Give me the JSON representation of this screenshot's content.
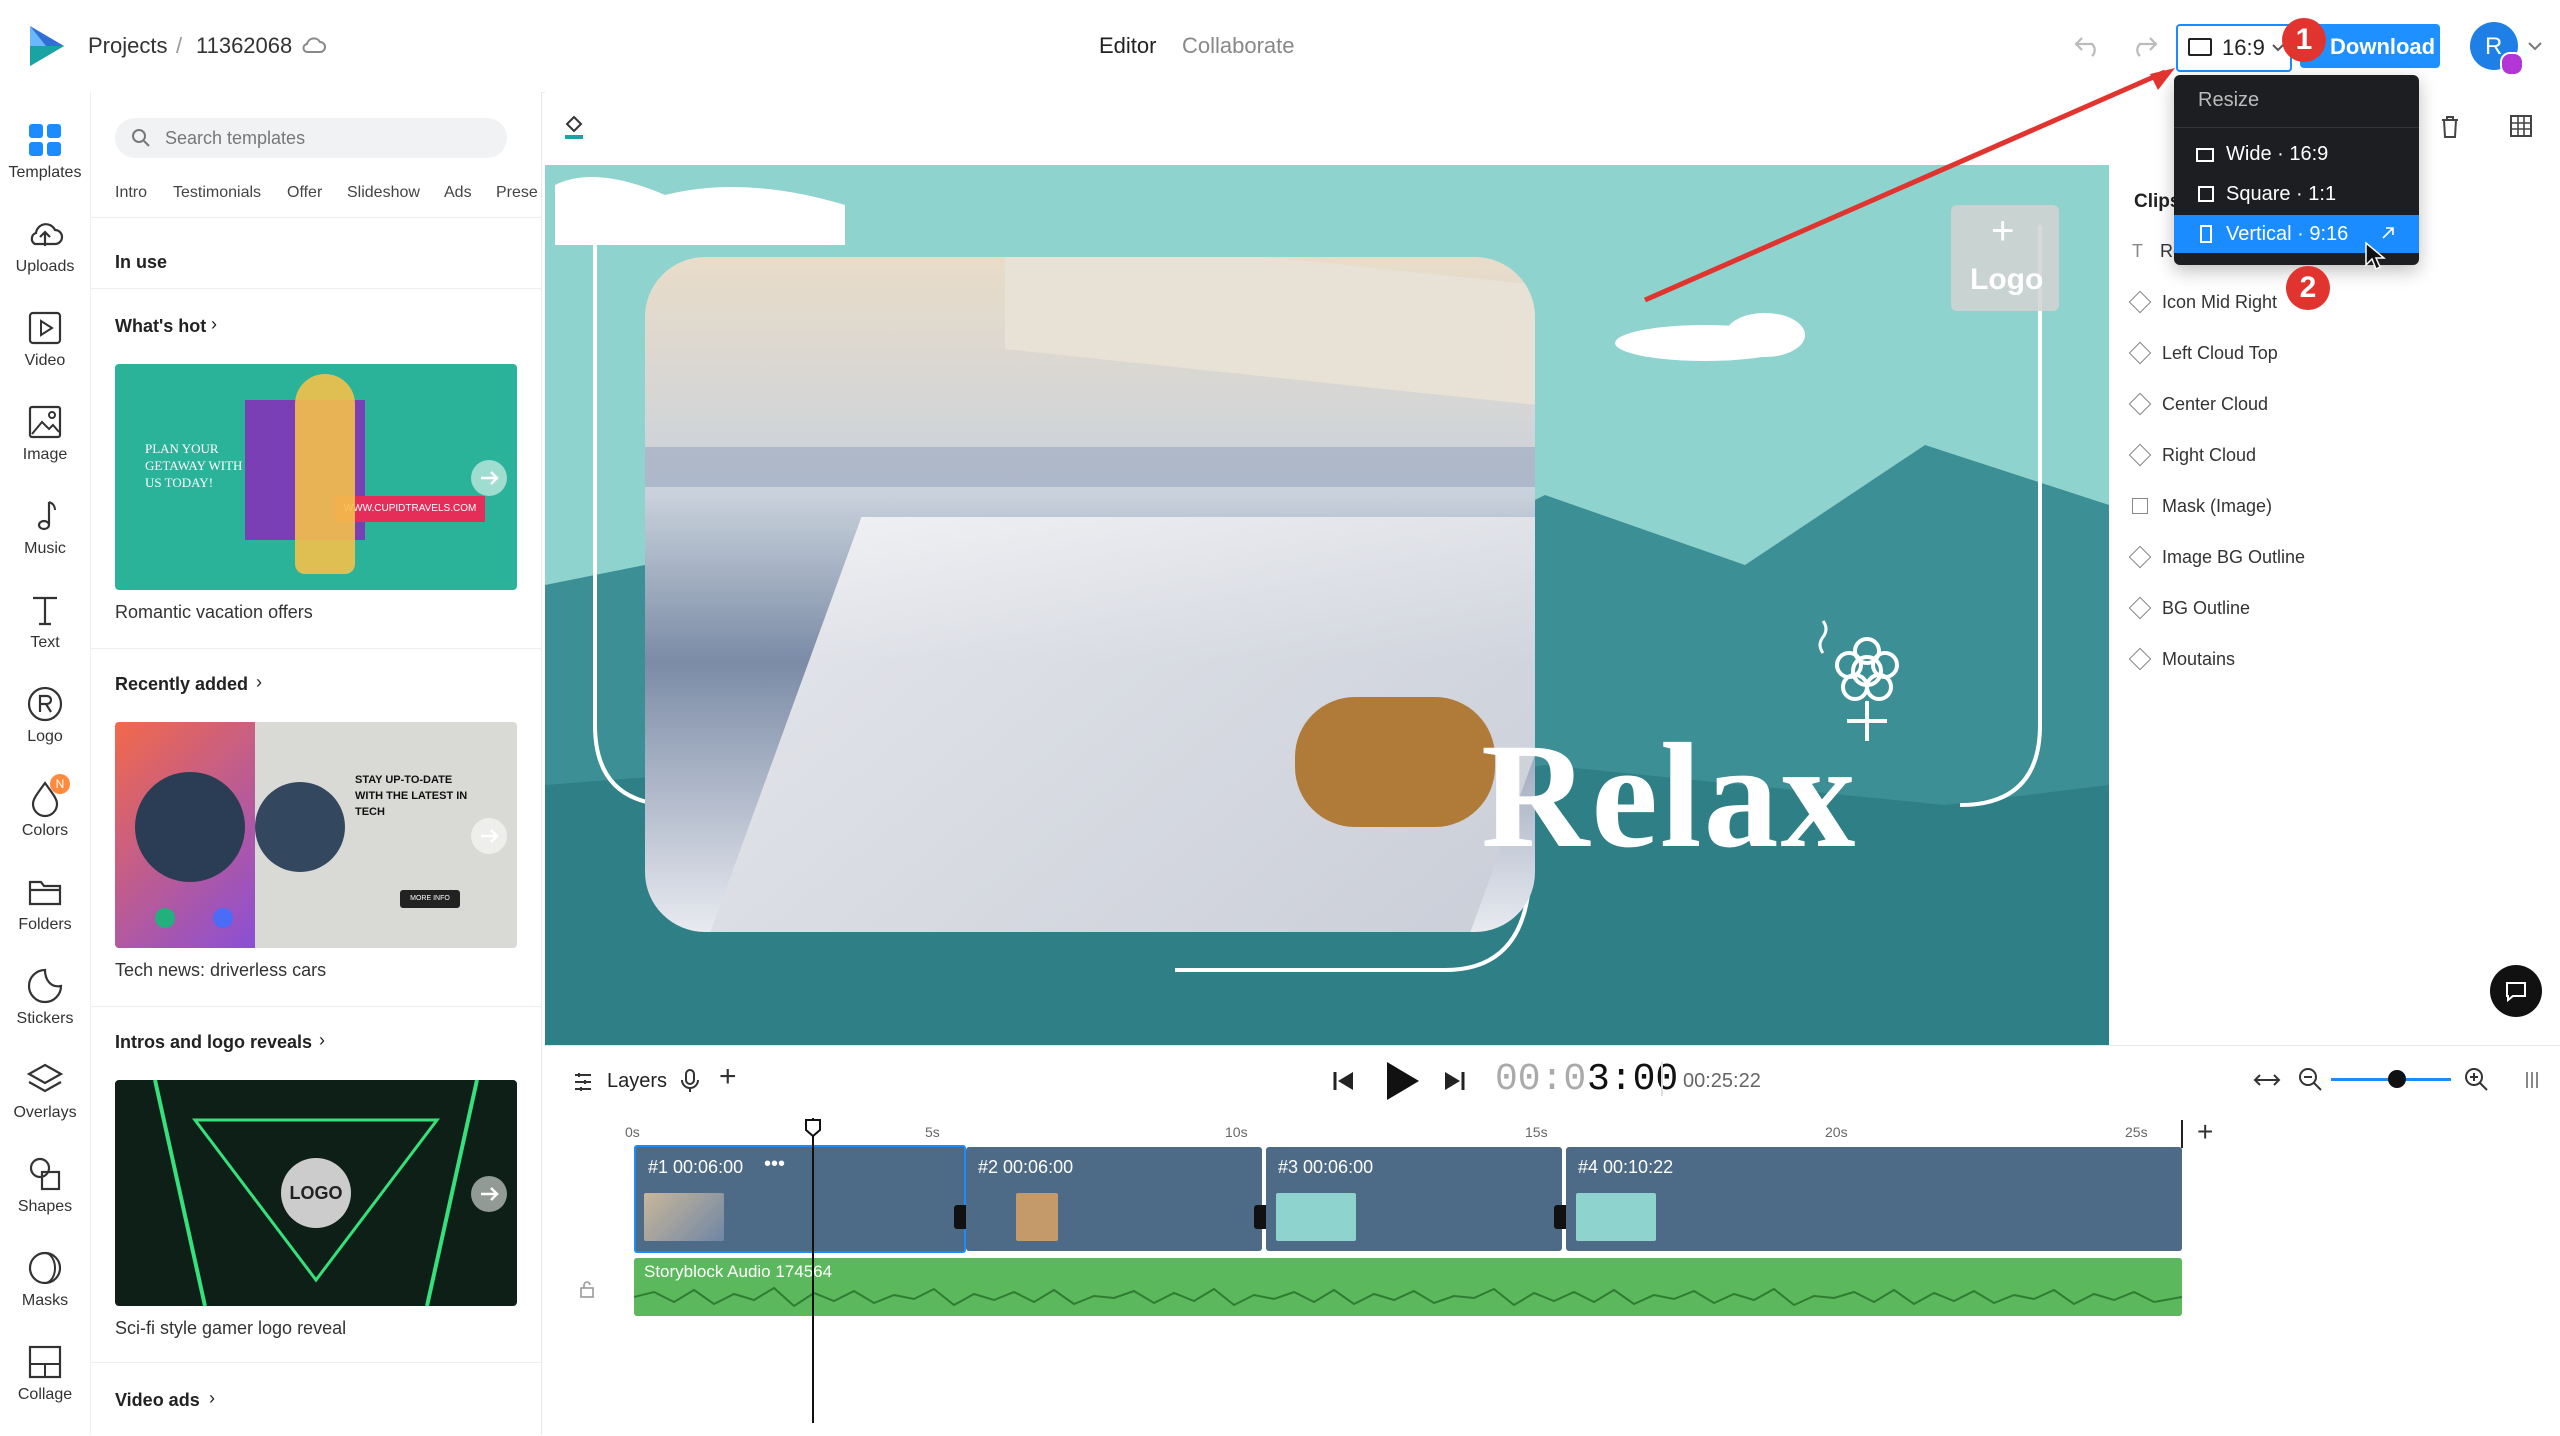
{
  "topbar": {
    "breadcrumb_projects": "Projects",
    "separator": "/",
    "project_id": "11362068",
    "tab_editor": "Editor",
    "tab_collaborate": "Collaborate",
    "aspect_label": "16:9",
    "download_label": "Download",
    "avatar_initial": "R"
  },
  "rail": {
    "items": [
      {
        "label": "Templates"
      },
      {
        "label": "Uploads"
      },
      {
        "label": "Video"
      },
      {
        "label": "Image"
      },
      {
        "label": "Music"
      },
      {
        "label": "Text"
      },
      {
        "label": "Logo"
      },
      {
        "label": "Colors"
      },
      {
        "label": "Folders"
      },
      {
        "label": "Stickers"
      },
      {
        "label": "Overlays"
      },
      {
        "label": "Shapes"
      },
      {
        "label": "Masks"
      },
      {
        "label": "Collage"
      }
    ],
    "colors_badge": "N"
  },
  "panel": {
    "search_placeholder": "Search templates",
    "chips": [
      "Intro",
      "Testimonials",
      "Offer",
      "Slideshow",
      "Ads",
      "Prese"
    ],
    "in_use": "In use",
    "sections": [
      {
        "title": "What's hot",
        "caption": "Romantic vacation offers",
        "thumb_text_1": "PLAN YOUR GETAWAY WITH US TODAY!",
        "thumb_text_2": "WWW.CUPIDTRAVELS.COM"
      },
      {
        "title": "Recently added",
        "caption": "Tech news: driverless cars",
        "thumb_text_1": "STAY UP-TO-DATE WITH THE LATEST IN TECH",
        "thumb_text_2": "MORE INFO"
      },
      {
        "title": "Intros and logo reveals",
        "caption": "Sci-fi style gamer logo reveal",
        "thumb_text_1": "LOGO"
      },
      {
        "title": "Video ads"
      }
    ]
  },
  "canvas": {
    "headline": "Relax",
    "logo_placeholder": "Logo"
  },
  "clips_panel": {
    "title": "Clips",
    "first_item_partial": "Re",
    "items": [
      "Icon Mid Right",
      "Left Cloud Top",
      "Center Cloud",
      "Right Cloud",
      "Mask (Image)",
      "Image BG Outline",
      "BG Outline",
      "Moutains"
    ]
  },
  "dropdown": {
    "title": "Resize",
    "options": [
      {
        "label": "Wide · 16:9"
      },
      {
        "label": "Square · 1:1"
      },
      {
        "label": "Vertical · 9:16",
        "selected": true
      }
    ]
  },
  "annotations": {
    "badge_1": "1",
    "badge_2": "2"
  },
  "timeline": {
    "layers_label": "Layers",
    "current_time": "00:03:00",
    "current_time_dim": "00:0",
    "current_time_bright": "3:00",
    "total_time": "00:25:22",
    "ruler": [
      "0s",
      "5s",
      "10s",
      "15s",
      "20s",
      "25s"
    ],
    "clips": [
      {
        "label": "#1  00:06:00"
      },
      {
        "label": "#2  00:06:00"
      },
      {
        "label": "#3  00:06:00"
      },
      {
        "label": "#4  00:10:22"
      }
    ],
    "audio_label": "Storyblock Audio 174564",
    "zoom_level": 0.55
  },
  "colors": {
    "accent": "#1a8cff",
    "download": "#1e90ff",
    "canvas_teal": "#2f7f86",
    "canvas_sky": "#8fd3cf",
    "clip_bg": "#4d6b86",
    "audio_bg": "#5cb85c",
    "badge_red": "#e2342e"
  }
}
